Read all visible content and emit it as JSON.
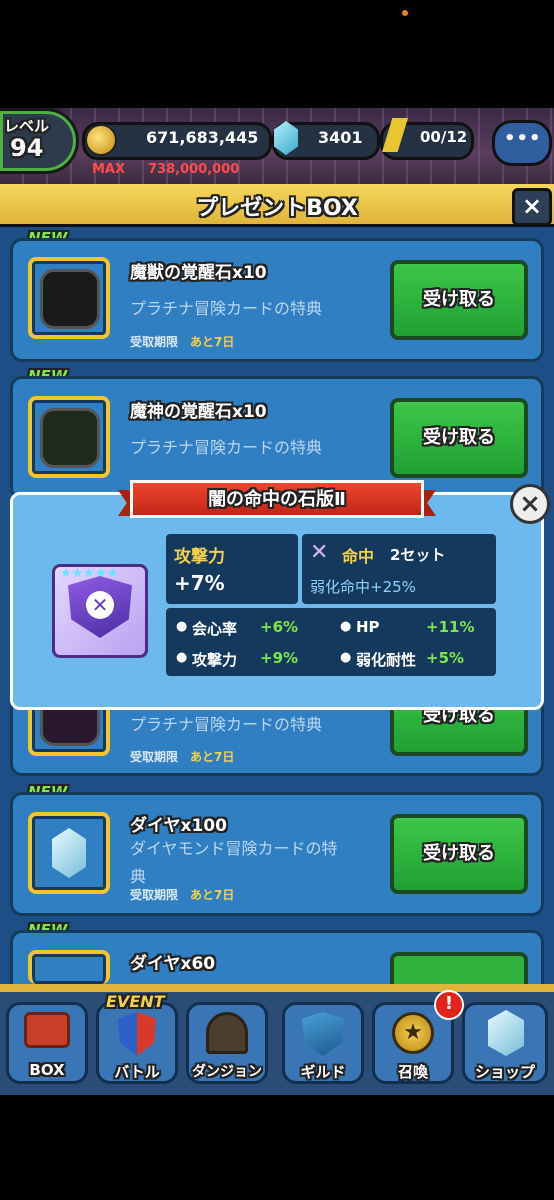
{
  "hud": {
    "level_label": "レベル",
    "level_value": "94",
    "coins": "671,683,445",
    "coins_max_label": "MAX",
    "coins_max": "738,000,000",
    "gems": "3401",
    "stamina": "00/12",
    "chat": "•••"
  },
  "modal": {
    "title": "プレゼントBOX",
    "close": "×",
    "new_label": "NEW",
    "expire_label": "受取期限",
    "days_left": "あと7日",
    "receive_label": "受け取る",
    "items": [
      {
        "name": "魔獣の覚醒石x10",
        "source": "プラチナ冒険カードの特典"
      },
      {
        "name": "魔神の覚醒石x10",
        "source": "プラチナ冒険カードの特典"
      },
      {
        "name": "",
        "source": "プラチナ冒険カードの特典"
      },
      {
        "name": "ダイヤx100",
        "source_line1": "ダイヤモンド冒険カードの特",
        "source_line2": "典"
      },
      {
        "name": "ダイヤx60"
      }
    ]
  },
  "popup": {
    "title": "闇の命中の石版Ⅱ",
    "stars": "★★★★★",
    "main_stat_label": "攻撃力",
    "main_stat_value": "+7%",
    "set_icon": "✕",
    "set_label": "命中",
    "set_count": "2セット",
    "set_effect": "弱化命中+25%",
    "sub_stats": [
      {
        "name": "会心率",
        "value": "+6%"
      },
      {
        "name": "HP",
        "value": "+11%"
      },
      {
        "name": "攻撃力",
        "value": "+9%"
      },
      {
        "name": "弱化耐性",
        "value": "+5%"
      }
    ]
  },
  "nav": {
    "event": "EVENT",
    "alert": "!",
    "items": [
      "BOX",
      "バトル",
      "ダンジョン",
      "ギルド",
      "召喚",
      "ショップ"
    ]
  }
}
